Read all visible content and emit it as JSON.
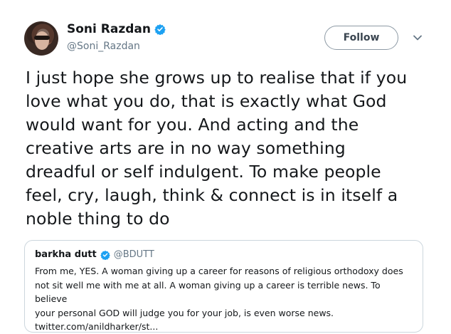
{
  "author": {
    "name": "Soni Razdan",
    "handle": "@Soni_Razdan"
  },
  "actions": {
    "follow_label": "Follow"
  },
  "tweet": {
    "lines": [
      "I just hope she grows up to realise that if you",
      "love what you do, that is exactly what God",
      "would want for you. And acting and the",
      "creative arts are in no way something",
      "dreadful or self indulgent. To make people",
      "feel, cry, laugh, think & connect is in itself a",
      "noble thing to do"
    ]
  },
  "quoted_tweet": {
    "name": "barkha dutt",
    "handle": "@BDUTT",
    "lines": [
      "From me, YES. A woman giving up a career for reasons of religious orthodoxy does",
      "not sit well me with me at all. A woman giving up a career is terrible news. To believe",
      "your personal GOD will judge you for your job, is even worse news."
    ],
    "link": "twitter.com/anildharker/st..."
  },
  "colors": {
    "verified": "#1da1f2",
    "secondary_text": "#657786",
    "border": "#ccd6dd"
  },
  "icons": [
    "verified-badge-icon",
    "chevron-down-icon"
  ]
}
